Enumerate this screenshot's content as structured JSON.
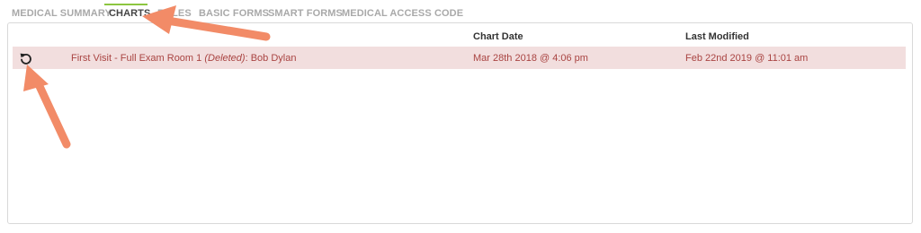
{
  "tabs": [
    {
      "label": "MEDICAL SUMMARY"
    },
    {
      "label": "CHARTS"
    },
    {
      "label": "RCLES"
    },
    {
      "label": "BASIC FORMS"
    },
    {
      "label": "SMART FORMS"
    },
    {
      "label": "MEDICAL ACCESS CODE"
    }
  ],
  "table": {
    "columns": {
      "chart_date": "Chart Date",
      "last_modified": "Last Modified"
    },
    "rows": [
      {
        "title": "First Visit - Full Exam Room 1",
        "deleted_tag": "(Deleted)",
        "patient_sep": ":",
        "patient": "Bob Dylan",
        "chart_date": "Mar 28th 2018 @ 4:06 pm",
        "last_modified": "Feb 22nd 2019 @ 11:01 am"
      }
    ]
  },
  "colors": {
    "accent": "#8cc63f",
    "row_bg": "#f2dede",
    "row_text": "#a94442",
    "annotation_arrow": "#f28b67"
  },
  "icons": {
    "restore": "undo-icon"
  }
}
